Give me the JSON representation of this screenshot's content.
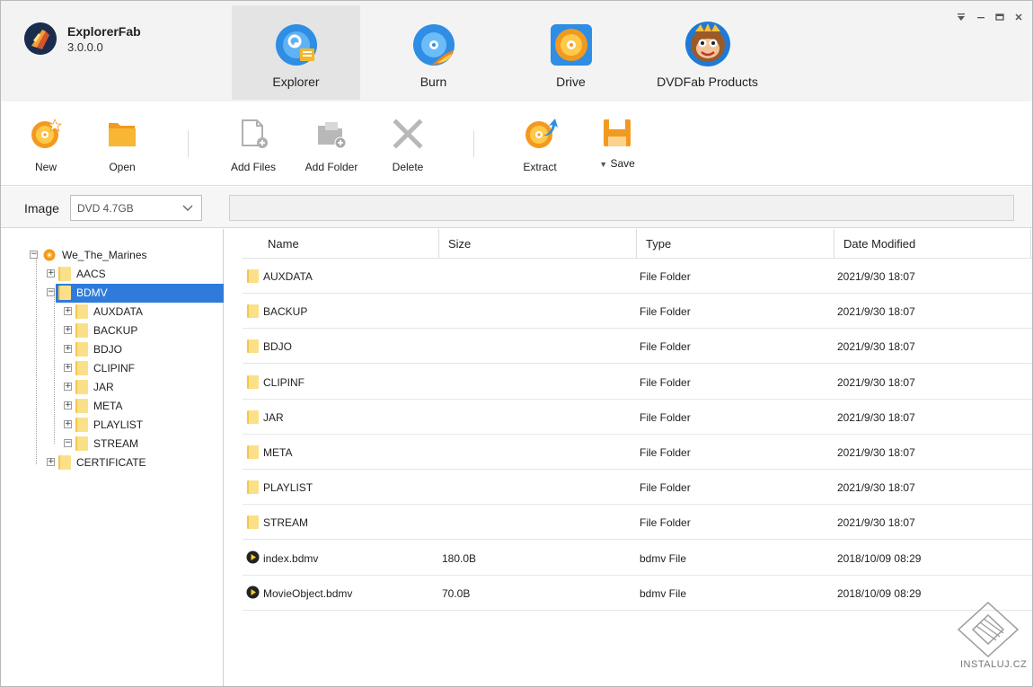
{
  "app": {
    "name": "ExplorerFab",
    "version": "3.0.0.0"
  },
  "nav": [
    {
      "label": "Explorer",
      "active": true
    },
    {
      "label": "Burn",
      "active": false
    },
    {
      "label": "Drive",
      "active": false
    },
    {
      "label": "DVDFab Products",
      "active": false
    }
  ],
  "toolbar": {
    "new_label": "New",
    "open_label": "Open",
    "add_files_label": "Add Files",
    "add_folder_label": "Add Folder",
    "delete_label": "Delete",
    "extract_label": "Extract",
    "save_label": "Save"
  },
  "image_row": {
    "label": "Image",
    "selected": "DVD 4.7GB",
    "path": ""
  },
  "tree": {
    "root": "We_The_Marines",
    "nodes": [
      {
        "label": "AACS",
        "expander": "+"
      },
      {
        "label": "BDMV",
        "expander": "−",
        "selected": true
      },
      {
        "label": "AUXDATA",
        "expander": "+"
      },
      {
        "label": "BACKUP",
        "expander": "+"
      },
      {
        "label": "BDJO",
        "expander": "+"
      },
      {
        "label": "CLIPINF",
        "expander": "+"
      },
      {
        "label": "JAR",
        "expander": "+"
      },
      {
        "label": "META",
        "expander": "+"
      },
      {
        "label": "PLAYLIST",
        "expander": "+"
      },
      {
        "label": "STREAM",
        "expander": "−"
      },
      {
        "label": "CERTIFICATE",
        "expander": "+"
      }
    ]
  },
  "columns": [
    "Name",
    "Size",
    "Type",
    "Date Modified"
  ],
  "rows": [
    {
      "name": "AUXDATA",
      "size": "",
      "type": "File Folder",
      "date": "2021/9/30 18:07",
      "kind": "folder"
    },
    {
      "name": "BACKUP",
      "size": "",
      "type": "File Folder",
      "date": "2021/9/30 18:07",
      "kind": "folder"
    },
    {
      "name": "BDJO",
      "size": "",
      "type": "File Folder",
      "date": "2021/9/30 18:07",
      "kind": "folder"
    },
    {
      "name": "CLIPINF",
      "size": "",
      "type": "File Folder",
      "date": "2021/9/30 18:07",
      "kind": "folder"
    },
    {
      "name": "JAR",
      "size": "",
      "type": "File Folder",
      "date": "2021/9/30 18:07",
      "kind": "folder"
    },
    {
      "name": "META",
      "size": "",
      "type": "File Folder",
      "date": "2021/9/30 18:07",
      "kind": "folder"
    },
    {
      "name": "PLAYLIST",
      "size": "",
      "type": "File Folder",
      "date": "2021/9/30 18:07",
      "kind": "folder"
    },
    {
      "name": "STREAM",
      "size": "",
      "type": "File Folder",
      "date": "2021/9/30 18:07",
      "kind": "folder"
    },
    {
      "name": "index.bdmv",
      "size": "180.0B",
      "type": "bdmv File",
      "date": "2018/10/09 08:29",
      "kind": "file"
    },
    {
      "name": "MovieObject.bdmv",
      "size": "70.0B",
      "type": "bdmv File",
      "date": "2018/10/09 08:29",
      "kind": "file"
    }
  ],
  "watermark": "INSTALUJ.CZ",
  "colors": {
    "accent": "#2e7bdb",
    "folder": "#fbe08a",
    "disc_orange": "#f29a1f",
    "disc_blue": "#2f8de4"
  },
  "icons": {
    "new": "new-disc-icon",
    "open": "open-folder-icon",
    "add_files": "add-files-icon",
    "add_folder": "add-folder-icon",
    "delete": "delete-x-icon",
    "extract": "extract-disc-icon",
    "save": "save-floppy-icon"
  }
}
